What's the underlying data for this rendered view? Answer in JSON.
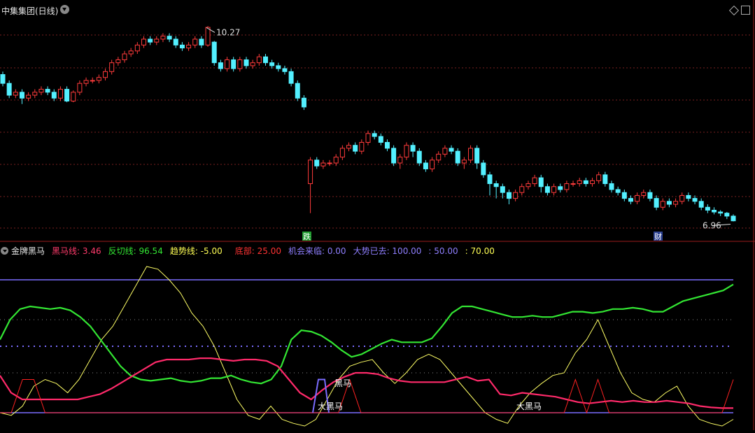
{
  "top": {
    "title": "中集集团(日线)",
    "high_label": "10.27",
    "low_label": "6.96"
  },
  "markers": [
    {
      "text": "跌",
      "bg": "#1f9b2f"
    },
    {
      "text": "财",
      "bg": "#2a3f8f"
    }
  ],
  "indicator": {
    "name": "金牌黑马",
    "items": [
      {
        "label": "黑马线:",
        "value": "3.46",
        "color": "#ff3b6b"
      },
      {
        "label": "反切线:",
        "value": "96.54",
        "color": "#33e633"
      },
      {
        "label": "趋势线:",
        "value": "-5.00",
        "color": "#ffff55"
      },
      {
        "label": "底部:",
        "value": "25.00",
        "color": "#ff3333"
      },
      {
        "label": "机会来临:",
        "value": "0.00",
        "color": "#8f7fff"
      },
      {
        "label": "大势已去:",
        "value": "100.00",
        "color": "#8f7fff"
      },
      {
        "label": ":",
        "value": "50.00",
        "color": "#8f7fff"
      },
      {
        "label": ":",
        "value": "70.00",
        "color": "#ffff55"
      }
    ],
    "labels": [
      "黑马",
      "大黑马",
      "大黑马"
    ]
  },
  "colors": {
    "up": "#ff3b3b",
    "down": "#53f0ff",
    "grid": "#7a1f1f",
    "purple": "#7b6cff",
    "green": "#33e633",
    "pink": "#ff2a6a",
    "yellow": "#ffff66",
    "red": "#ff2222"
  },
  "chart_data": {
    "type": "candlestick+indicator",
    "price": {
      "ylim": [
        6.8,
        10.5
      ],
      "max_price": 10.27,
      "min_price": 6.96,
      "candles": [
        [
          9.45,
          9.3,
          9.5,
          9.25
        ],
        [
          9.3,
          9.1,
          9.35,
          9.05
        ],
        [
          9.1,
          9.15,
          9.2,
          9.05
        ],
        [
          9.15,
          9.05,
          9.2,
          8.95
        ],
        [
          9.05,
          9.1,
          9.15,
          9.0
        ],
        [
          9.1,
          9.15,
          9.2,
          9.05
        ],
        [
          9.15,
          9.2,
          9.25,
          9.1
        ],
        [
          9.2,
          9.15,
          9.25,
          9.1
        ],
        [
          9.15,
          9.05,
          9.2,
          9.0
        ],
        [
          9.05,
          9.2,
          9.25,
          9.0
        ],
        [
          9.2,
          9.0,
          9.25,
          8.98
        ],
        [
          9.0,
          9.15,
          9.18,
          8.98
        ],
        [
          9.15,
          9.3,
          9.35,
          9.1
        ],
        [
          9.3,
          9.35,
          9.4,
          9.25
        ],
        [
          9.35,
          9.35,
          9.4,
          9.3
        ],
        [
          9.35,
          9.4,
          9.45,
          9.3
        ],
        [
          9.4,
          9.5,
          9.55,
          9.35
        ],
        [
          9.5,
          9.65,
          9.7,
          9.45
        ],
        [
          9.65,
          9.7,
          9.75,
          9.6
        ],
        [
          9.7,
          9.8,
          9.85,
          9.65
        ],
        [
          9.8,
          9.85,
          9.9,
          9.75
        ],
        [
          9.85,
          9.95,
          10.0,
          9.8
        ],
        [
          9.95,
          10.05,
          10.1,
          9.9
        ],
        [
          10.05,
          10.0,
          10.1,
          9.95
        ],
        [
          10.0,
          10.05,
          10.1,
          9.95
        ],
        [
          10.05,
          10.1,
          10.15,
          10.0
        ],
        [
          10.1,
          10.05,
          10.15,
          10.0
        ],
        [
          10.05,
          9.95,
          10.1,
          9.9
        ],
        [
          9.95,
          9.9,
          10.0,
          9.85
        ],
        [
          9.9,
          9.95,
          10.0,
          9.85
        ],
        [
          9.95,
          10.05,
          10.1,
          9.9
        ],
        [
          10.05,
          9.95,
          10.1,
          9.9
        ],
        [
          9.95,
          10.25,
          10.27,
          9.92
        ],
        [
          10.0,
          9.65,
          10.02,
          9.6
        ],
        [
          9.65,
          9.55,
          9.7,
          9.5
        ],
        [
          9.55,
          9.7,
          9.75,
          9.5
        ],
        [
          9.7,
          9.55,
          9.75,
          9.5
        ],
        [
          9.55,
          9.7,
          9.75,
          9.5
        ],
        [
          9.7,
          9.6,
          9.75,
          9.55
        ],
        [
          9.6,
          9.65,
          9.7,
          9.55
        ],
        [
          9.65,
          9.75,
          9.8,
          9.6
        ],
        [
          9.75,
          9.65,
          9.8,
          9.6
        ],
        [
          9.65,
          9.6,
          9.7,
          9.55
        ],
        [
          9.6,
          9.55,
          9.65,
          9.5
        ],
        [
          9.55,
          9.5,
          9.6,
          9.45
        ],
        [
          9.5,
          9.3,
          9.55,
          9.25
        ],
        [
          9.3,
          9.05,
          9.35,
          9.0
        ],
        [
          9.05,
          8.9,
          9.1,
          8.85
        ],
        [
          7.6,
          8.0,
          8.05,
          7.1
        ],
        [
          8.0,
          7.9,
          8.05,
          7.85
        ],
        [
          7.9,
          7.95,
          8.0,
          7.85
        ],
        [
          7.95,
          7.95,
          8.0,
          7.9
        ],
        [
          7.95,
          8.05,
          8.1,
          7.9
        ],
        [
          8.05,
          8.2,
          8.25,
          8.0
        ],
        [
          8.2,
          8.25,
          8.3,
          8.15
        ],
        [
          8.25,
          8.15,
          8.3,
          8.1
        ],
        [
          8.15,
          8.3,
          8.35,
          8.1
        ],
        [
          8.3,
          8.45,
          8.5,
          8.25
        ],
        [
          8.45,
          8.4,
          8.5,
          8.35
        ],
        [
          8.4,
          8.3,
          8.45,
          8.25
        ],
        [
          8.3,
          8.2,
          8.35,
          8.15
        ],
        [
          8.2,
          7.95,
          8.25,
          7.9
        ],
        [
          7.95,
          8.05,
          8.1,
          7.85
        ],
        [
          8.05,
          8.25,
          8.3,
          8.0
        ],
        [
          8.25,
          8.15,
          8.3,
          8.05
        ],
        [
          8.15,
          7.95,
          8.2,
          7.9
        ],
        [
          7.95,
          7.85,
          8.0,
          7.8
        ],
        [
          7.85,
          8.0,
          8.05,
          7.8
        ],
        [
          8.0,
          8.1,
          8.15,
          7.95
        ],
        [
          8.1,
          8.2,
          8.25,
          8.05
        ],
        [
          8.2,
          8.15,
          8.25,
          8.1
        ],
        [
          8.15,
          7.95,
          8.2,
          7.9
        ],
        [
          7.95,
          8.0,
          8.05,
          7.85
        ],
        [
          8.0,
          8.2,
          8.25,
          7.95
        ],
        [
          8.2,
          7.95,
          8.25,
          7.85
        ],
        [
          7.95,
          7.75,
          8.0,
          7.7
        ],
        [
          7.75,
          7.6,
          7.8,
          7.4
        ],
        [
          7.6,
          7.55,
          7.65,
          7.35
        ],
        [
          7.55,
          7.45,
          7.6,
          7.35
        ],
        [
          7.45,
          7.35,
          7.5,
          7.25
        ],
        [
          7.35,
          7.45,
          7.5,
          7.3
        ],
        [
          7.45,
          7.55,
          7.6,
          7.4
        ],
        [
          7.55,
          7.6,
          7.65,
          7.5
        ],
        [
          7.6,
          7.7,
          7.75,
          7.55
        ],
        [
          7.7,
          7.55,
          7.75,
          7.45
        ],
        [
          7.55,
          7.45,
          7.6,
          7.4
        ],
        [
          7.45,
          7.55,
          7.6,
          7.4
        ],
        [
          7.55,
          7.5,
          7.6,
          7.45
        ],
        [
          7.5,
          7.6,
          7.65,
          7.45
        ],
        [
          7.6,
          7.6,
          7.65,
          7.55
        ],
        [
          7.6,
          7.65,
          7.7,
          7.55
        ],
        [
          7.65,
          7.6,
          7.7,
          7.55
        ],
        [
          7.6,
          7.65,
          7.7,
          7.55
        ],
        [
          7.65,
          7.75,
          7.8,
          7.6
        ],
        [
          7.75,
          7.6,
          7.8,
          7.55
        ],
        [
          7.6,
          7.5,
          7.65,
          7.45
        ],
        [
          7.5,
          7.45,
          7.55,
          7.4
        ],
        [
          7.45,
          7.35,
          7.5,
          7.3
        ],
        [
          7.35,
          7.3,
          7.4,
          7.25
        ],
        [
          7.3,
          7.4,
          7.45,
          7.25
        ],
        [
          7.4,
          7.45,
          7.5,
          7.35
        ],
        [
          7.45,
          7.35,
          7.5,
          7.3
        ],
        [
          7.35,
          7.2,
          7.4,
          7.15
        ],
        [
          7.2,
          7.3,
          7.35,
          7.15
        ],
        [
          7.3,
          7.25,
          7.35,
          7.2
        ],
        [
          7.25,
          7.3,
          7.35,
          7.2
        ],
        [
          7.3,
          7.4,
          7.45,
          7.25
        ],
        [
          7.4,
          7.35,
          7.45,
          7.3
        ],
        [
          7.35,
          7.3,
          7.4,
          7.25
        ],
        [
          7.3,
          7.2,
          7.35,
          7.15
        ],
        [
          7.2,
          7.15,
          7.25,
          7.1
        ],
        [
          7.15,
          7.12,
          7.2,
          7.08
        ],
        [
          7.12,
          7.1,
          7.15,
          7.05
        ],
        [
          7.1,
          7.05,
          7.12,
          7.0
        ],
        [
          7.05,
          6.97,
          7.08,
          6.96
        ]
      ]
    },
    "indicator": {
      "ylim": [
        -10,
        110
      ],
      "levels": {
        "大势已去": 100,
        "机会来临": 0,
        "50": 50,
        "70": 70
      },
      "series": [
        {
          "name": "反切线",
          "values": [
            55,
            70,
            78,
            80,
            79,
            78,
            79,
            77,
            72,
            65,
            55,
            45,
            35,
            28,
            25,
            24,
            25,
            26,
            24,
            23,
            24,
            26,
            26,
            28,
            25,
            23,
            22,
            25,
            35,
            55,
            62,
            61,
            58,
            53,
            47,
            42,
            44,
            48,
            52,
            55,
            53,
            53,
            53,
            56,
            65,
            75,
            80,
            80,
            78,
            76,
            74,
            72,
            72,
            73,
            72,
            72,
            74,
            76,
            76,
            75,
            76,
            78,
            78,
            79,
            78,
            76,
            76,
            80,
            84,
            86,
            88,
            90,
            92,
            96.54
          ]
        },
        {
          "name": "黑马线",
          "values": [
            28,
            15,
            10,
            10,
            10,
            10,
            10,
            10,
            12,
            14,
            18,
            23,
            28,
            33,
            38,
            40,
            40,
            40,
            41,
            41,
            40,
            39,
            40,
            40,
            39,
            35,
            25,
            15,
            10,
            17,
            23,
            27,
            30,
            30,
            29,
            26,
            24,
            23,
            23,
            23,
            23,
            25,
            27,
            24,
            25,
            14,
            13,
            15,
            14,
            13,
            12,
            10,
            8,
            7,
            8,
            9,
            8,
            9,
            8,
            8,
            9,
            8,
            7,
            5,
            4,
            3.46,
            3.46
          ]
        },
        {
          "name": "趋势线",
          "values": [
            0,
            -2,
            5,
            20,
            25,
            22,
            15,
            25,
            40,
            55,
            65,
            80,
            95,
            110,
            108,
            100,
            90,
            75,
            65,
            50,
            30,
            10,
            -2,
            -5,
            5,
            -5,
            -8,
            -10,
            -5,
            10,
            25,
            35,
            38,
            40,
            30,
            22,
            30,
            40,
            44,
            40,
            30,
            20,
            10,
            0,
            -5,
            -8,
            5,
            15,
            22,
            28,
            30,
            45,
            55,
            70,
            50,
            30,
            15,
            10,
            8,
            15,
            20,
            5,
            -5,
            -8,
            -10,
            -5
          ]
        },
        {
          "name": "底部",
          "values": [
            0,
            0,
            25,
            25,
            0,
            0,
            0,
            0,
            0,
            0,
            0,
            0,
            0,
            0,
            0,
            0,
            0,
            0,
            0,
            0,
            0,
            0,
            0,
            0,
            0,
            0,
            0,
            0,
            0,
            0,
            0,
            25,
            0,
            0,
            0,
            0,
            0,
            0,
            0,
            0,
            0,
            0,
            0,
            0,
            0,
            0,
            0,
            0,
            0,
            0,
            0,
            25,
            0,
            25,
            0,
            0,
            0,
            0,
            0,
            0,
            0,
            0,
            0,
            0,
            0,
            25
          ]
        },
        {
          "name": "机会来临",
          "values": [
            0,
            0,
            0,
            0,
            0,
            0,
            0,
            0,
            0,
            0,
            0,
            0,
            0,
            0,
            0,
            0,
            0,
            0,
            0,
            0,
            0,
            0,
            0,
            0,
            0,
            0,
            0,
            0,
            0,
            0,
            0,
            0,
            0,
            0,
            0,
            0,
            0,
            0,
            0,
            0,
            0,
            0,
            0,
            0,
            0,
            0,
            0,
            0,
            0,
            0,
            0,
            0,
            0,
            0,
            0,
            0,
            0,
            0,
            0,
            0,
            0,
            0,
            0,
            0,
            0,
            0
          ]
        },
        {
          "name": "大势已去",
          "values": [
            100,
            100,
            100,
            100,
            100,
            100,
            100,
            100,
            100,
            100,
            100,
            100,
            100,
            100,
            100,
            100,
            100,
            100,
            100,
            100,
            100,
            100,
            100,
            100,
            100,
            100,
            100,
            100,
            100,
            100,
            100,
            100,
            100,
            100,
            100,
            100,
            100,
            100,
            100,
            100,
            100,
            100,
            100,
            100,
            100,
            100,
            100,
            100,
            100,
            100,
            100,
            100,
            100,
            100,
            100,
            100,
            100,
            100,
            100,
            100,
            100,
            100,
            100,
            100,
            100,
            100
          ]
        }
      ]
    }
  }
}
